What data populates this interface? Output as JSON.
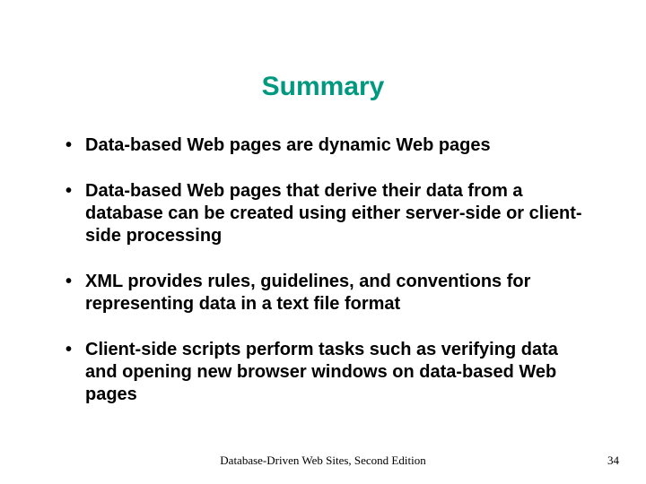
{
  "title": "Summary",
  "bullets": [
    "Data-based Web pages are dynamic Web pages",
    "Data-based Web pages that derive their data from a database can be created using either server-side or client-side processing",
    "XML provides rules, guidelines, and conventions for representing data in a text file format",
    "Client-side scripts perform tasks such as verifying data and opening new browser windows on data-based Web pages"
  ],
  "footer": {
    "source": "Database-Driven Web Sites, Second Edition",
    "page": "34"
  }
}
